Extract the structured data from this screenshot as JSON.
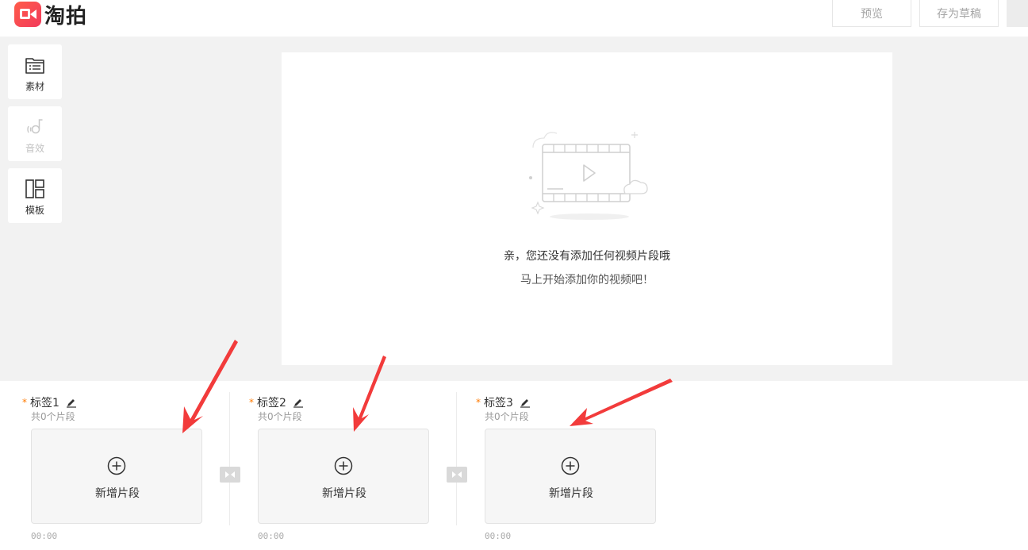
{
  "header": {
    "app_name": "淘拍",
    "preview_label": "预览",
    "save_draft_label": "存为草稿"
  },
  "sidebar": {
    "items": [
      {
        "label": "素材",
        "icon": "material-folder-icon",
        "enabled": true
      },
      {
        "label": "音效",
        "icon": "sound-effect-icon",
        "enabled": false
      },
      {
        "label": "模板",
        "icon": "template-layout-icon",
        "enabled": true
      }
    ]
  },
  "preview": {
    "empty_line1": "亲，您还没有添加任何视频片段哦",
    "empty_line2": "马上开始添加你的视频吧！"
  },
  "groups": [
    {
      "tag": "标签1",
      "count": "共0个片段",
      "add_label": "新增片段",
      "time": "00:00"
    },
    {
      "tag": "标签2",
      "count": "共0个片段",
      "add_label": "新增片段",
      "time": "00:00"
    },
    {
      "tag": "标签3",
      "count": "共0个片段",
      "add_label": "新增片段",
      "time": "00:00"
    }
  ],
  "colors": {
    "brand": "#f23a5b",
    "required_star": "#ff7a00",
    "annotation_arrow": "#f23b3b"
  }
}
